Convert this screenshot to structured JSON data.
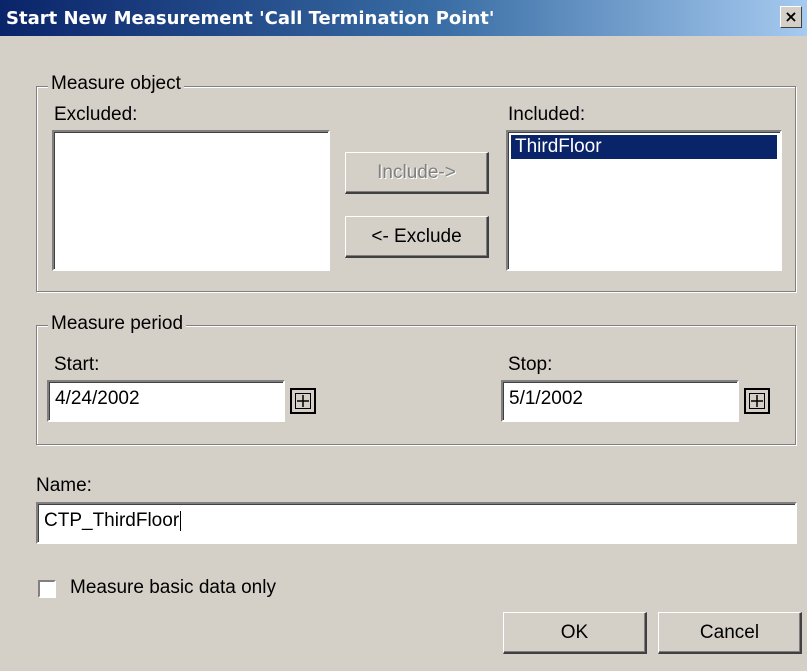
{
  "dialog": {
    "title": "Start New Measurement 'Call Termination Point'",
    "close_glyph": "×"
  },
  "measure_object": {
    "legend": "Measure object",
    "excluded_label": "Excluded:",
    "excluded_items": [],
    "included_label": "Included:",
    "included_items": [
      "ThirdFloor"
    ],
    "include_button": "Include->",
    "exclude_button": "<- Exclude"
  },
  "measure_period": {
    "legend": "Measure period",
    "start_label": "Start:",
    "start_value": "4/24/2002",
    "stop_label": "Stop:",
    "stop_value": "5/1/2002"
  },
  "name": {
    "label": "Name:",
    "value": "CTP_ThirdFloor"
  },
  "basic_data_checkbox": {
    "label": "Measure basic data only",
    "checked": false
  },
  "buttons": {
    "ok": "OK",
    "cancel": "Cancel"
  }
}
